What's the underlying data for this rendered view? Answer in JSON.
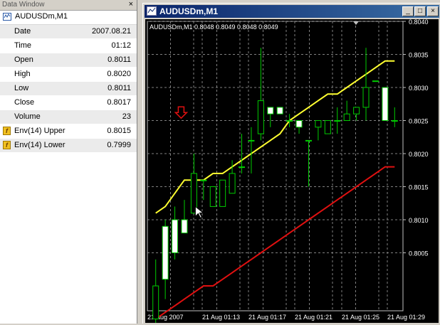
{
  "data_window": {
    "title": "Data Window",
    "close_glyph": "×",
    "symbol": "AUDUSDm,M1",
    "rows": [
      {
        "label": "Date",
        "value": "2007.08.21",
        "icon": null
      },
      {
        "label": "Time",
        "value": "01:12",
        "icon": null
      },
      {
        "label": "Open",
        "value": "0.8011",
        "icon": null
      },
      {
        "label": "High",
        "value": "0.8020",
        "icon": null
      },
      {
        "label": "Low",
        "value": "0.8011",
        "icon": null
      },
      {
        "label": "Close",
        "value": "0.8017",
        "icon": null
      },
      {
        "label": "Volume",
        "value": "23",
        "icon": null
      },
      {
        "label": "Env(14) Upper",
        "value": "0.8015",
        "icon": "indicator-icon"
      },
      {
        "label": "Env(14) Lower",
        "value": "0.7999",
        "icon": "indicator-icon"
      }
    ]
  },
  "chart_window": {
    "title": "AUDUSDm,M1",
    "buttons": [
      "_",
      "□",
      "×"
    ]
  },
  "colors": {
    "chart_bg": "#000000",
    "grid": "#808080",
    "candle": "#00cc00",
    "upper_env": "#ffff30",
    "lower_env": "#e01010",
    "arrow": "#e01010",
    "text": "#ffffff"
  },
  "chart_data": {
    "type": "candlestick",
    "info_line": "AUDUSDm,M1  0.8048 0.8049 0.8048 0.8049",
    "y_ticks": [
      "0.8040",
      "0.8035",
      "0.8030",
      "0.8025",
      "0.8020",
      "0.8015",
      "0.8010",
      "0.8005"
    ],
    "x_ticks": [
      "21 Aug 2007",
      "21 Aug 01:13",
      "21 Aug 01:17",
      "21 Aug 01:21",
      "21 Aug 01:25",
      "21 Aug 01:29"
    ],
    "ylim": [
      0.8,
      0.804
    ],
    "candles": [
      {
        "o": 0.7995,
        "h": 0.8004,
        "l": 0.7993,
        "c": 0.8
      },
      {
        "o": 0.8009,
        "h": 0.801,
        "l": 0.7998,
        "c": 0.8001
      },
      {
        "o": 0.801,
        "h": 0.8012,
        "l": 0.8004,
        "c": 0.8005
      },
      {
        "o": 0.801,
        "h": 0.8013,
        "l": 0.8008,
        "c": 0.8008
      },
      {
        "o": 0.8011,
        "h": 0.802,
        "l": 0.8011,
        "c": 0.8017
      },
      {
        "o": 0.8016,
        "h": 0.8016,
        "l": 0.8013,
        "c": 0.8016
      },
      {
        "o": 0.8012,
        "h": 0.8015,
        "l": 0.8012,
        "c": 0.8015
      },
      {
        "o": 0.8012,
        "h": 0.8016,
        "l": 0.8012,
        "c": 0.8016
      },
      {
        "o": 0.8014,
        "h": 0.8019,
        "l": 0.8014,
        "c": 0.8017
      },
      {
        "o": 0.8018,
        "h": 0.8023,
        "l": 0.8017,
        "c": 0.8018
      },
      {
        "o": 0.8022,
        "h": 0.8024,
        "l": 0.8017,
        "c": 0.8022
      },
      {
        "o": 0.8023,
        "h": 0.8036,
        "l": 0.8022,
        "c": 0.8028
      },
      {
        "o": 0.8027,
        "h": 0.8027,
        "l": 0.8024,
        "c": 0.8026
      },
      {
        "o": 0.8027,
        "h": 0.8027,
        "l": 0.8026,
        "c": 0.8026
      },
      {
        "o": 0.8025,
        "h": 0.8026,
        "l": 0.8024,
        "c": 0.8025
      },
      {
        "o": 0.8025,
        "h": 0.8025,
        "l": 0.8023,
        "c": 0.8024
      },
      {
        "o": 0.8022,
        "h": 0.8022,
        "l": 0.8015,
        "c": 0.8022
      },
      {
        "o": 0.8024,
        "h": 0.8025,
        "l": 0.8022,
        "c": 0.8025
      },
      {
        "o": 0.8023,
        "h": 0.8025,
        "l": 0.8023,
        "c": 0.8025
      },
      {
        "o": 0.8025,
        "h": 0.8027,
        "l": 0.8023,
        "c": 0.8025
      },
      {
        "o": 0.8025,
        "h": 0.8028,
        "l": 0.8025,
        "c": 0.8026
      },
      {
        "o": 0.8026,
        "h": 0.8026,
        "l": 0.8025,
        "c": 0.8027
      },
      {
        "o": 0.8027,
        "h": 0.8036,
        "l": 0.8025,
        "c": 0.803
      },
      {
        "o": 0.8031,
        "h": 0.8031,
        "l": 0.8031,
        "c": 0.8031
      },
      {
        "o": 0.803,
        "h": 0.803,
        "l": 0.8025,
        "c": 0.8025
      },
      {
        "o": 0.8025,
        "h": 0.8027,
        "l": 0.8024,
        "c": 0.8025
      }
    ],
    "series": [
      {
        "name": "Env(14) Upper",
        "values": [
          0.8011,
          0.8012,
          0.8014,
          0.8016,
          0.8016,
          0.8016,
          0.8017,
          0.8017,
          0.8018,
          0.8019,
          0.802,
          0.8021,
          0.8022,
          0.8023,
          0.8025,
          0.8026,
          0.8027,
          0.8028,
          0.8029,
          0.8029,
          0.803,
          0.8031,
          0.8032,
          0.8033,
          0.8034,
          0.8034
        ]
      },
      {
        "name": "Env(14) Lower",
        "values": [
          0.7995,
          0.7996,
          0.7997,
          0.7998,
          0.7999,
          0.8,
          0.8,
          0.8001,
          0.8002,
          0.8003,
          0.8004,
          0.8005,
          0.8006,
          0.8007,
          0.8008,
          0.8009,
          0.801,
          0.8011,
          0.8012,
          0.8013,
          0.8014,
          0.8015,
          0.8016,
          0.8017,
          0.8018,
          0.8018
        ]
      }
    ],
    "marker": {
      "type": "down-arrow",
      "x_index": 4
    }
  }
}
